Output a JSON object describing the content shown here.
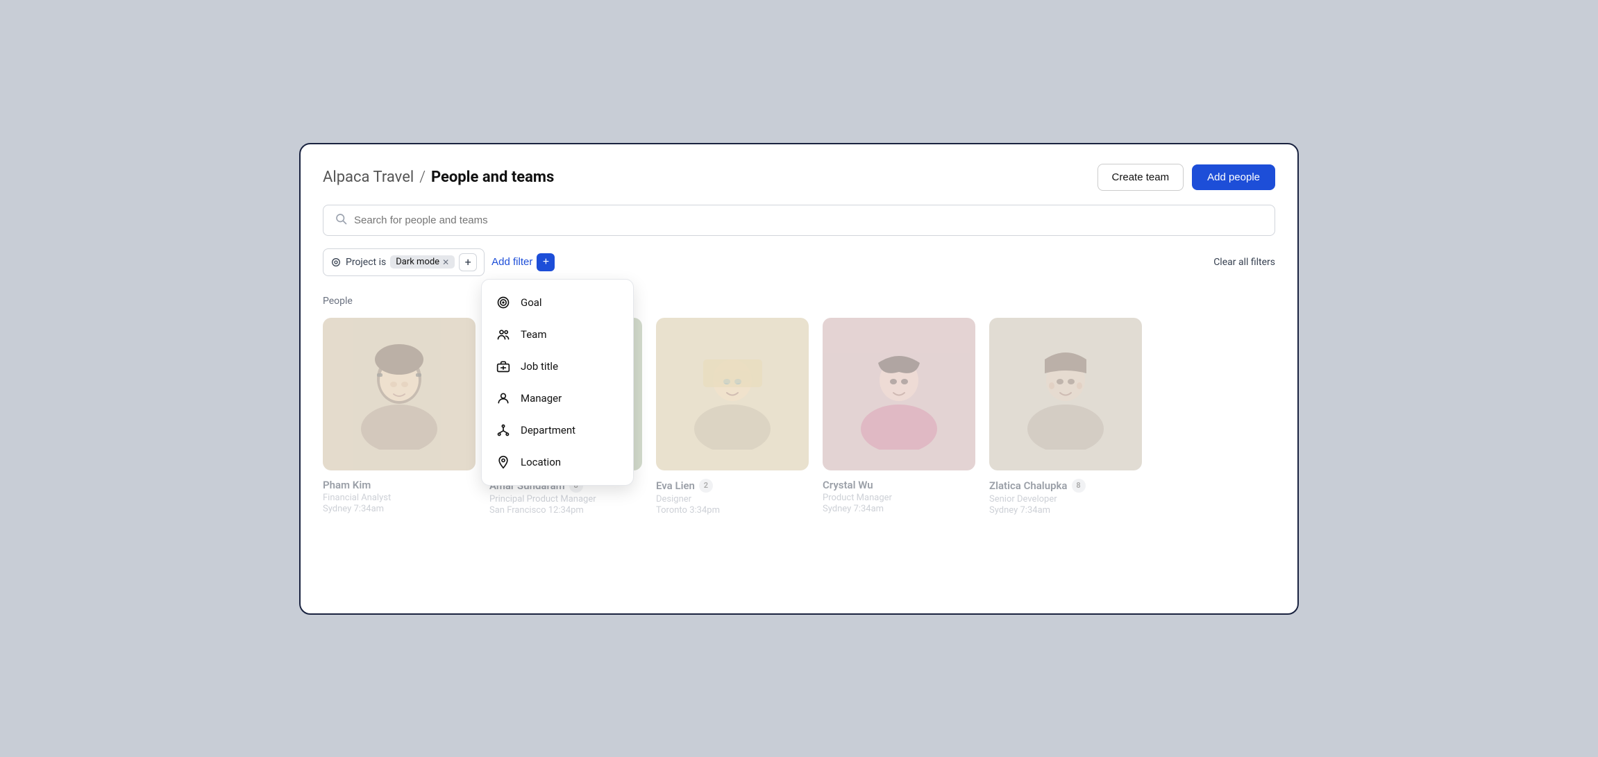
{
  "app": {
    "parent": "Alpaca Travel",
    "separator": "/",
    "title": "People and teams"
  },
  "header": {
    "create_team_label": "Create team",
    "add_people_label": "Add people"
  },
  "search": {
    "placeholder": "Search for people and teams"
  },
  "filters": {
    "project_label": "Project is",
    "project_value": "Dark mode",
    "add_filter_label": "Add filter",
    "clear_label": "Clear all filters"
  },
  "dropdown": {
    "items": [
      {
        "id": "goal",
        "label": "Goal",
        "icon": "goal"
      },
      {
        "id": "team",
        "label": "Team",
        "icon": "team"
      },
      {
        "id": "job_title",
        "label": "Job title",
        "icon": "briefcase"
      },
      {
        "id": "manager",
        "label": "Manager",
        "icon": "person"
      },
      {
        "id": "department",
        "label": "Department",
        "icon": "department"
      },
      {
        "id": "location",
        "label": "Location",
        "icon": "location"
      }
    ]
  },
  "section": {
    "label": "People"
  },
  "people": [
    {
      "name": "Pham Kim",
      "badge": null,
      "role": "Financial Analyst",
      "city": "Sydney",
      "time": "7:34am",
      "avatar_color": "#c4b89a",
      "dimmed": true
    },
    {
      "name": "Amar Sundaram",
      "badge": "8",
      "role": "Principal Product Manager",
      "city": "San Francisco",
      "time": "12:34pm",
      "avatar_color": "#a8b89a",
      "dimmed": true
    },
    {
      "name": "Eva Lien",
      "badge": "2",
      "role": "Designer",
      "city": "Toronto",
      "time": "3:34pm",
      "avatar_color": "#d4c49e",
      "dimmed": true
    },
    {
      "name": "Crystal Wu",
      "badge": null,
      "role": "Product Manager",
      "city": "Sydney",
      "time": "7:34am",
      "avatar_color": "#c9a8a8",
      "dimmed": true
    },
    {
      "name": "Zlatica Chalupka",
      "badge": "8",
      "role": "Senior Developer",
      "city": "Sydney",
      "time": "7:34am",
      "avatar_color": "#c4baa8",
      "dimmed": true
    }
  ]
}
